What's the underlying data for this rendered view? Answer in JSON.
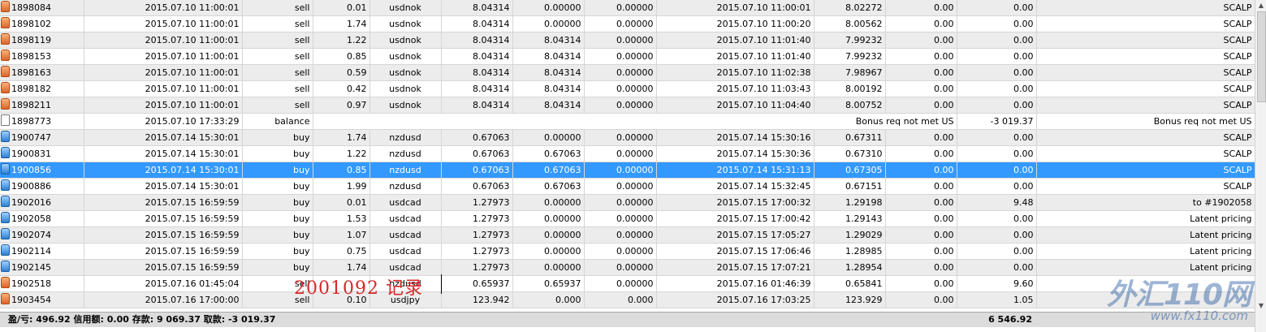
{
  "rows": [
    {
      "ticket": "1898084",
      "open_time": "2015.07.10 11:00:01",
      "type": "sell",
      "size": "0.01",
      "symbol": "usdnok",
      "price": "8.04314",
      "sl": "0.00000",
      "tp": "0.00000",
      "close_time": "2015.07.10 11:00:01",
      "close_price": "8.02272",
      "commission": "0.00",
      "swap": "0.00",
      "profit": "SCALP",
      "icon": "sell-icon"
    },
    {
      "ticket": "1898102",
      "open_time": "2015.07.10 11:00:01",
      "type": "sell",
      "size": "1.74",
      "symbol": "usdnok",
      "price": "8.04314",
      "sl": "0.00000",
      "tp": "0.00000",
      "close_time": "2015.07.10 11:00:20",
      "close_price": "8.00562",
      "commission": "0.00",
      "swap": "0.00",
      "profit": "SCALP",
      "icon": "sell-icon"
    },
    {
      "ticket": "1898119",
      "open_time": "2015.07.10 11:00:01",
      "type": "sell",
      "size": "1.22",
      "symbol": "usdnok",
      "price": "8.04314",
      "sl": "8.04314",
      "tp": "0.00000",
      "close_time": "2015.07.10 11:01:40",
      "close_price": "7.99232",
      "commission": "0.00",
      "swap": "0.00",
      "profit": "SCALP",
      "icon": "sell-icon"
    },
    {
      "ticket": "1898153",
      "open_time": "2015.07.10 11:00:01",
      "type": "sell",
      "size": "0.85",
      "symbol": "usdnok",
      "price": "8.04314",
      "sl": "8.04314",
      "tp": "0.00000",
      "close_time": "2015.07.10 11:01:40",
      "close_price": "7.99232",
      "commission": "0.00",
      "swap": "0.00",
      "profit": "SCALP",
      "icon": "sell-icon"
    },
    {
      "ticket": "1898163",
      "open_time": "2015.07.10 11:00:01",
      "type": "sell",
      "size": "0.59",
      "symbol": "usdnok",
      "price": "8.04314",
      "sl": "8.04314",
      "tp": "0.00000",
      "close_time": "2015.07.10 11:02:38",
      "close_price": "7.98967",
      "commission": "0.00",
      "swap": "0.00",
      "profit": "SCALP",
      "icon": "sell-icon"
    },
    {
      "ticket": "1898182",
      "open_time": "2015.07.10 11:00:01",
      "type": "sell",
      "size": "0.42",
      "symbol": "usdnok",
      "price": "8.04314",
      "sl": "8.04314",
      "tp": "0.00000",
      "close_time": "2015.07.10 11:03:43",
      "close_price": "8.00192",
      "commission": "0.00",
      "swap": "0.00",
      "profit": "SCALP",
      "icon": "sell-icon"
    },
    {
      "ticket": "1898211",
      "open_time": "2015.07.10 11:00:01",
      "type": "sell",
      "size": "0.97",
      "symbol": "usdnok",
      "price": "8.04314",
      "sl": "8.04314",
      "tp": "0.00000",
      "close_time": "2015.07.10 11:04:40",
      "close_price": "8.00752",
      "commission": "0.00",
      "swap": "0.00",
      "profit": "SCALP",
      "icon": "sell-icon"
    },
    {
      "ticket": "1898773",
      "open_time": "2015.07.10 17:33:29",
      "type": "balance",
      "size": "",
      "symbol": "",
      "price": "",
      "sl": "",
      "tp": "",
      "close_time": "",
      "close_price": "Bonus req not met US",
      "commission": "",
      "swap": "-3 019.37",
      "profit": "Bonus req not met US",
      "icon": "balance-icon",
      "balance": true
    },
    {
      "ticket": "1900747",
      "open_time": "2015.07.14 15:30:01",
      "type": "buy",
      "size": "1.74",
      "symbol": "nzdusd",
      "price": "0.67063",
      "sl": "0.00000",
      "tp": "0.00000",
      "close_time": "2015.07.14 15:30:16",
      "close_price": "0.67311",
      "commission": "0.00",
      "swap": "0.00",
      "profit": "SCALP",
      "icon": "buy-icon"
    },
    {
      "ticket": "1900831",
      "open_time": "2015.07.14 15:30:01",
      "type": "buy",
      "size": "1.22",
      "symbol": "nzdusd",
      "price": "0.67063",
      "sl": "0.67063",
      "tp": "0.00000",
      "close_time": "2015.07.14 15:30:36",
      "close_price": "0.67310",
      "commission": "0.00",
      "swap": "0.00",
      "profit": "SCALP",
      "icon": "buy-icon"
    },
    {
      "ticket": "1900856",
      "open_time": "2015.07.14 15:30:01",
      "type": "buy",
      "size": "0.85",
      "symbol": "nzdusd",
      "price": "0.67063",
      "sl": "0.67063",
      "tp": "0.00000",
      "close_time": "2015.07.14 15:31:13",
      "close_price": "0.67305",
      "commission": "0.00",
      "swap": "0.00",
      "profit": "SCALP",
      "icon": "buy-icon",
      "selected": true
    },
    {
      "ticket": "1900886",
      "open_time": "2015.07.14 15:30:01",
      "type": "buy",
      "size": "1.99",
      "symbol": "nzdusd",
      "price": "0.67063",
      "sl": "0.67063",
      "tp": "0.00000",
      "close_time": "2015.07.14 15:32:45",
      "close_price": "0.67151",
      "commission": "0.00",
      "swap": "0.00",
      "profit": "SCALP",
      "icon": "buy-icon"
    },
    {
      "ticket": "1902016",
      "open_time": "2015.07.15 16:59:59",
      "type": "buy",
      "size": "0.01",
      "symbol": "usdcad",
      "price": "1.27973",
      "sl": "0.00000",
      "tp": "0.00000",
      "close_time": "2015.07.15 17:00:32",
      "close_price": "1.29198",
      "commission": "0.00",
      "swap": "9.48",
      "profit": "to #1902058",
      "icon": "buy-icon"
    },
    {
      "ticket": "1902058",
      "open_time": "2015.07.15 16:59:59",
      "type": "buy",
      "size": "1.53",
      "symbol": "usdcad",
      "price": "1.27973",
      "sl": "0.00000",
      "tp": "0.00000",
      "close_time": "2015.07.15 17:00:42",
      "close_price": "1.29143",
      "commission": "0.00",
      "swap": "0.00",
      "profit": "Latent pricing",
      "icon": "buy-icon"
    },
    {
      "ticket": "1902074",
      "open_time": "2015.07.15 16:59:59",
      "type": "buy",
      "size": "1.07",
      "symbol": "usdcad",
      "price": "1.27973",
      "sl": "0.00000",
      "tp": "0.00000",
      "close_time": "2015.07.15 17:05:27",
      "close_price": "1.29029",
      "commission": "0.00",
      "swap": "0.00",
      "profit": "Latent pricing",
      "icon": "buy-icon"
    },
    {
      "ticket": "1902114",
      "open_time": "2015.07.15 16:59:59",
      "type": "buy",
      "size": "0.75",
      "symbol": "usdcad",
      "price": "1.27973",
      "sl": "0.00000",
      "tp": "0.00000",
      "close_time": "2015.07.15 17:06:46",
      "close_price": "1.28985",
      "commission": "0.00",
      "swap": "0.00",
      "profit": "Latent pricing",
      "icon": "buy-icon"
    },
    {
      "ticket": "1902145",
      "open_time": "2015.07.15 16:59:59",
      "type": "buy",
      "size": "1.74",
      "symbol": "usdcad",
      "price": "1.27973",
      "sl": "0.00000",
      "tp": "0.00000",
      "close_time": "2015.07.15 17:07:21",
      "close_price": "1.28954",
      "commission": "0.00",
      "swap": "0.00",
      "profit": "Latent pricing",
      "icon": "buy-icon"
    },
    {
      "ticket": "1902518",
      "open_time": "2015.07.16 01:45:04",
      "type": "sell",
      "size": "",
      "symbol": "nzdusd",
      "price": "0.65937",
      "sl": "0.65937",
      "tp": "0.00000",
      "close_time": "2015.07.16 01:46:39",
      "close_price": "0.65841",
      "commission": "0.00",
      "swap": "9.60",
      "profit": "",
      "icon": "sell-icon"
    },
    {
      "ticket": "1903454",
      "open_time": "2015.07.16 17:00:00",
      "type": "sell",
      "size": "0.10",
      "symbol": "usdjpy",
      "price": "123.942",
      "sl": "0.000",
      "tp": "0.000",
      "close_time": "2015.07.16 17:03:25",
      "close_price": "123.929",
      "commission": "0.00",
      "swap": "1.05",
      "profit": "",
      "icon": "sell-icon"
    }
  ],
  "summary": {
    "text": "盈/亏: 496.92  信用额: 0.00  存款: 9 069.37  取款: -3 019.37",
    "total": "6 546.92"
  },
  "annotation": "2001092 记录",
  "watermark": {
    "brand": "外汇110网",
    "url": "www.fx110.com"
  },
  "colors": {
    "selected_row": "#3399ff",
    "alt_row": "#ececec",
    "annotation": "#d42a2a"
  }
}
